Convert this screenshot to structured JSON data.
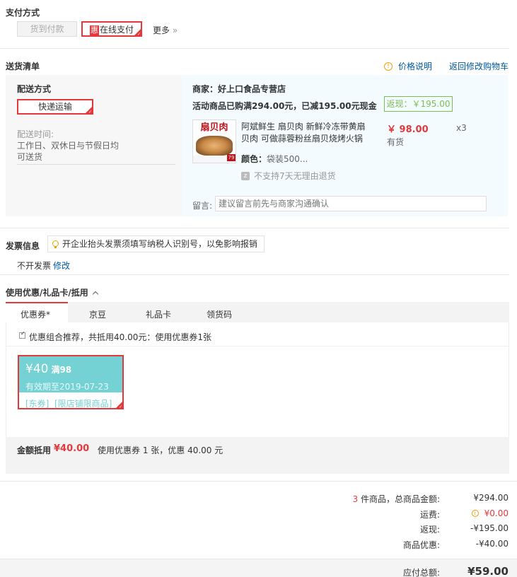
{
  "payment": {
    "title": "支付方式",
    "cod_label": "货到付款",
    "online_badge": "惠",
    "online_label": "在线支付",
    "more_label": "更多",
    "more_arrow": "»"
  },
  "shipping_list": {
    "title": "送货清单",
    "price_note_label": "价格说明",
    "price_note_icon": "info-circle-icon",
    "back_to_cart_label": "返回修改购物车"
  },
  "delivery": {
    "method_title": "配送方式",
    "method_value": "快递运输",
    "time_title": "配送时间:",
    "time_line1": "工作日、双休日与节假日均",
    "time_line2": "可送货"
  },
  "merchant": {
    "name_line": "商家：好上口食品专营店",
    "promo_line": "活动商品已购满294.00元，已减195.00元现金",
    "rebate_label": "返现：￥195.00"
  },
  "product": {
    "image_text": "扇贝肉",
    "image_badge": "79",
    "title_line1": "阿斌鲜生 扇贝肉 新鲜冷冻带黄扇",
    "title_line2": "贝肉 可做蒜蓉粉丝扇贝烧烤火锅",
    "color_label": "颜色：",
    "color_value": "袋装500...",
    "no_return_icon": "z",
    "no_return_text": "不支持7天无理由退货",
    "price": "￥ 98.00",
    "stock": "有货",
    "qty": "x3"
  },
  "message": {
    "label": "留言:",
    "placeholder": "建议留言前先与商家沟通确认"
  },
  "invoice": {
    "title": "发票信息",
    "tip": "开企业抬头发票须填写纳税人识别号，以免影响报销",
    "value": "不开发票",
    "edit_label": "修改"
  },
  "coupons": {
    "title": "使用优惠/礼品卡/抵用",
    "tabs": [
      "优惠券*",
      "京豆",
      "礼品卡",
      "领货码"
    ],
    "combo_text": "优惠组合推荐，共抵用40.00元：使用优惠券1张",
    "card": {
      "amount": "¥40",
      "threshold": "满98",
      "expiry": "有效期至2019-07-23",
      "tags": "[东券]  [限店铺限商品]"
    },
    "deduct_label": "金额抵用",
    "deduct_value": "¥40.00",
    "deduct_note": "使用优惠券 1 张，优惠 40.00 元"
  },
  "summary": {
    "count": "3",
    "count_suffix": " 件商品，总商品金额:",
    "total_goods": "¥294.00",
    "shipping_label": "运费:",
    "shipping_value": "¥0.00",
    "rebate_label": "返现:",
    "rebate_value": "-¥195.00",
    "discount_label": "商品优惠:",
    "discount_value": "-¥40.00",
    "payable_label": "应付总额:",
    "payable_value": "¥59.00"
  },
  "colors": {
    "accent_red": "#e4393c",
    "link_blue": "#005aa0",
    "store_bg": "#f3fbfe",
    "coupon_teal": "#74d2d4"
  }
}
